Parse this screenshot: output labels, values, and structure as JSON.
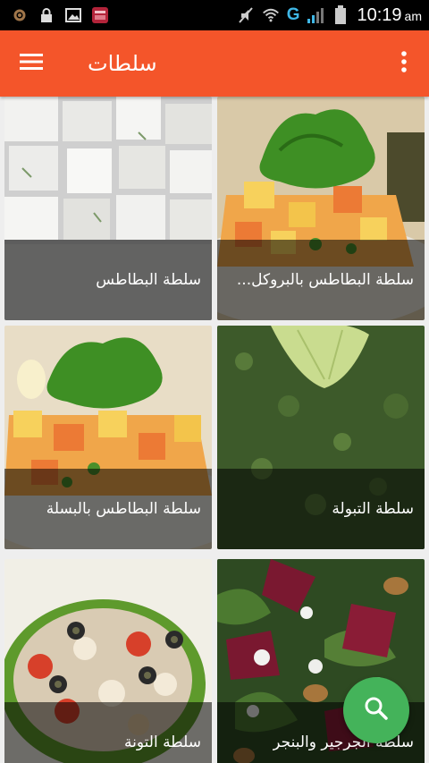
{
  "status_bar": {
    "time": "10:19",
    "ampm": "am",
    "network": "G",
    "icons": [
      "settings-icon",
      "lock-icon",
      "image-icon",
      "app-icon",
      "mute-icon",
      "wifi-icon",
      "signal-icon",
      "battery-icon"
    ]
  },
  "toolbar": {
    "title": "سلطات",
    "menu_icon": "hamburger-icon",
    "overflow_icon": "more-vertical-icon",
    "color": "#f4552a"
  },
  "recipes": [
    {
      "name": "سلطة البطاطس بالبروكل..."
    },
    {
      "name": "سلطة البطاطس"
    },
    {
      "name": "سلطة التبولة"
    },
    {
      "name": "سلطة البطاطس بالبسلة"
    },
    {
      "name": "سلطة الجرجير والبنجر"
    },
    {
      "name": "سلطة التونة"
    }
  ],
  "fab": {
    "icon": "search-icon",
    "color": "#44b35a"
  }
}
